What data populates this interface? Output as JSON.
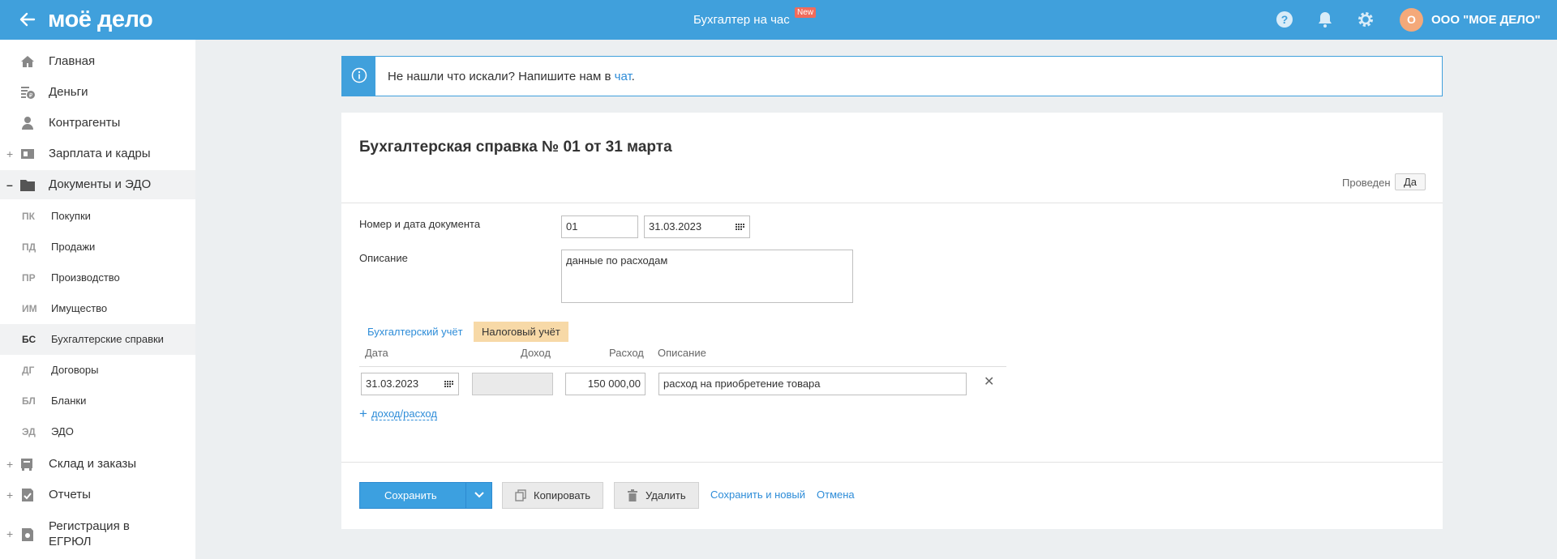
{
  "header": {
    "logo": "моё дело",
    "center_link": "Бухгалтер на час",
    "new_badge": "New",
    "avatar_letter": "О",
    "org_name": "ООО \"МОЕ ДЕЛО\"",
    "accent_color": "#40a0dc"
  },
  "sidebar": {
    "items": [
      {
        "label": "Главная",
        "icon": "home-icon"
      },
      {
        "label": "Деньги",
        "icon": "money-icon"
      },
      {
        "label": "Контрагенты",
        "icon": "contractors-icon"
      },
      {
        "label": "Зарплата и кадры",
        "icon": "salary-icon",
        "sign": "+"
      },
      {
        "label": "Документы и ЭДО",
        "icon": "folder-icon",
        "sign": "–"
      },
      {
        "label": "Склад и заказы",
        "icon": "warehouse-icon",
        "sign": "+"
      },
      {
        "label": "Отчеты",
        "icon": "reports-icon",
        "sign": "+"
      },
      {
        "label": "Регистрация в ЕГРЮЛ",
        "icon": "registration-icon",
        "sign": "+"
      }
    ],
    "sub_items": [
      {
        "code": "ПК",
        "label": "Покупки"
      },
      {
        "code": "ПД",
        "label": "Продажи"
      },
      {
        "code": "ПР",
        "label": "Производство"
      },
      {
        "code": "ИМ",
        "label": "Имущество"
      },
      {
        "code": "БС",
        "label": "Бухгалтерские справки",
        "active": true
      },
      {
        "code": "ДГ",
        "label": "Договоры"
      },
      {
        "code": "БЛ",
        "label": "Бланки"
      },
      {
        "code": "ЭД",
        "label": "ЭДО"
      }
    ]
  },
  "banner": {
    "text": "Не нашли что искали? Напишите нам в ",
    "link": "чат",
    "tail": "."
  },
  "document": {
    "title": "Бухгалтерская справка № 01 от 31 марта",
    "posted_label": "Проведен",
    "posted_value": "Да",
    "number_date_label": "Номер и дата документа",
    "number": "01",
    "date": "31.03.2023",
    "description_label": "Описание",
    "description": "данные по расходам",
    "tabs": [
      {
        "label": "Бухгалтерский учёт",
        "active": false
      },
      {
        "label": "Налоговый учёт",
        "active": true
      }
    ],
    "columns": {
      "date": "Дата",
      "income": "Доход",
      "expense": "Расход",
      "description": "Описание"
    },
    "rows": [
      {
        "date": "31.03.2023",
        "income": "",
        "expense": "150 000,00",
        "description": "расход на приобретение товара"
      }
    ],
    "add_row": "доход/расход"
  },
  "actions": {
    "save": "Сохранить",
    "copy": "Копировать",
    "delete": "Удалить",
    "save_new": "Сохранить и новый",
    "cancel": "Отмена"
  }
}
